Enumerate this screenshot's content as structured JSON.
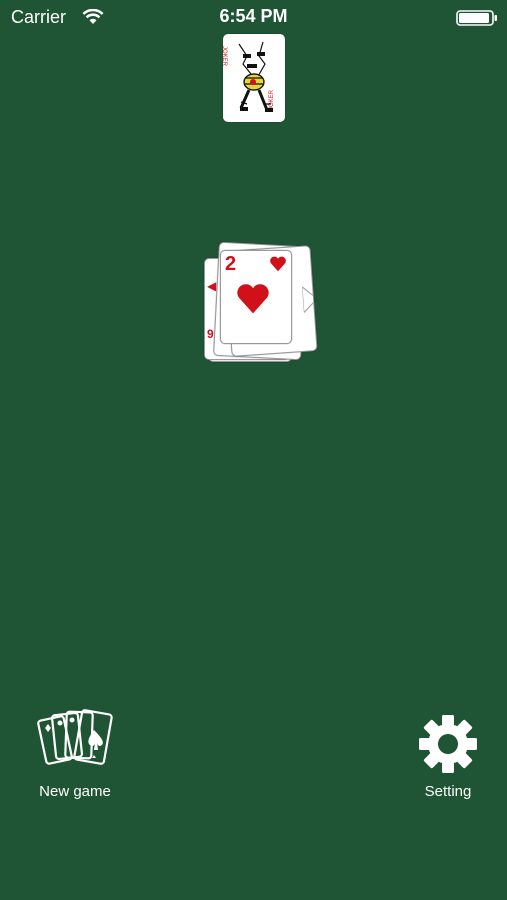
{
  "status_bar": {
    "carrier": "Carrier",
    "time": "6:54 PM",
    "icons": [
      "wifi-icon",
      "battery-icon"
    ]
  },
  "table": {
    "background_color": "#1f5435",
    "top_card": {
      "type": "joker"
    },
    "pile": {
      "top_card": {
        "rank": "2",
        "suit": "hearts",
        "color": "#d0111a"
      }
    }
  },
  "toolbar": {
    "new_game_label": "New game",
    "settings_label": "Setting",
    "new_game_icon": "cards-fan-icon",
    "settings_icon": "gear-icon"
  }
}
